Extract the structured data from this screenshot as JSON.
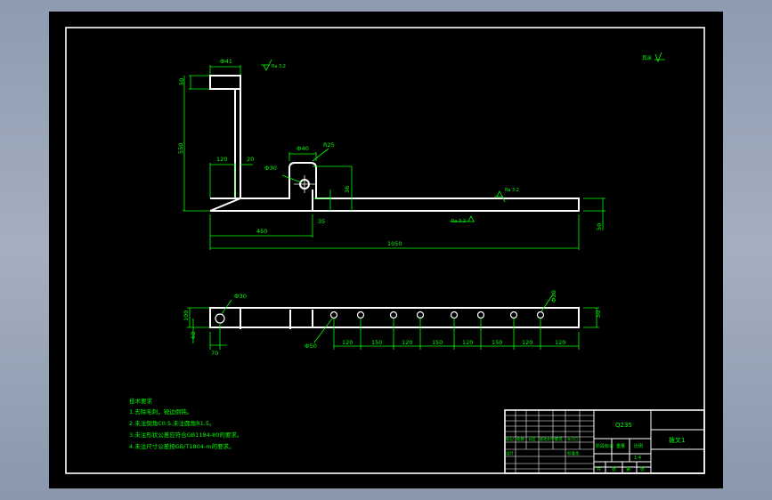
{
  "drawing": {
    "part_outline_color": "#ffffff",
    "dimension_color": "#00ff00",
    "frame_color": "#ffffff",
    "background": "#000000"
  },
  "dims": {
    "top_width": "Ф41",
    "top_height": "50",
    "vertical_height": "550",
    "left_width": "120",
    "web_width": "20",
    "slot_width": "Ф40",
    "slot_radius": "R25",
    "hole_dia": "Ф30",
    "slot_depth": "36",
    "rib_small": "35",
    "half_length": "450",
    "total_length": "1050",
    "right_height": "50",
    "rough_1": "Ra 3.2",
    "rough_2": "Ra 3.2",
    "rough_3": "Ra 3.2",
    "rough_other": "其余"
  },
  "plan_dims": {
    "end_hole": "Ф30",
    "right_hole": "Ф20",
    "height_left": "100",
    "height_left2": "60",
    "left_offset": "70",
    "bolt_hole": "Ф50",
    "right_height": "50",
    "spacings": [
      "120",
      "150",
      "120",
      "150",
      "120",
      "150",
      "120",
      "120"
    ]
  },
  "notes": {
    "title": "技术要求",
    "lines": [
      "1.去除毛刺，锐边倒钝。",
      "2.未注倒角C0.5,未注圆角R1.5。",
      "3.未注形状公差应符合GB1184-80的要求。",
      "4.未注尺寸公差按GB/T1804-m的要求。"
    ]
  },
  "title_block": {
    "material": "Q235",
    "part_name": "拨叉1",
    "stage_label": "阶段标记",
    "weight_label": "重量",
    "scale_label": "比例",
    "scale_value": "1:4",
    "sheet_labels": [
      "共",
      "张",
      "第",
      "张"
    ],
    "row_labels": [
      "标记",
      "处数",
      "分区",
      "更改文件号",
      "签名",
      "年月日"
    ],
    "design_label": "设计",
    "std_label": "标准化"
  }
}
